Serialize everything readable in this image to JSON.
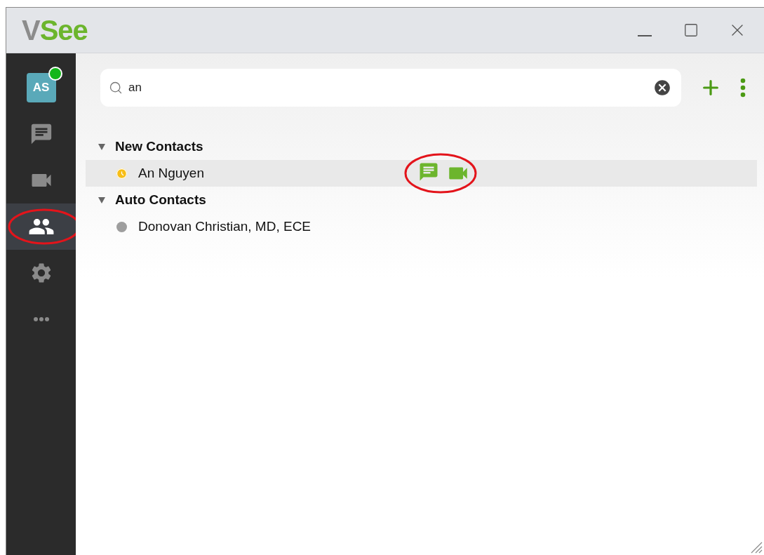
{
  "window": {
    "logo": {
      "mark": "V",
      "name": "See"
    }
  },
  "sidebar": {
    "items": [
      {
        "kind": "avatar",
        "label": "AS",
        "online": true,
        "selected": false,
        "annotated": false
      },
      {
        "kind": "chat",
        "selected": false,
        "annotated": false
      },
      {
        "kind": "video",
        "selected": false,
        "annotated": false
      },
      {
        "kind": "contacts",
        "selected": true,
        "annotated": true
      },
      {
        "kind": "settings",
        "selected": false,
        "annotated": false
      },
      {
        "kind": "more",
        "selected": false,
        "annotated": false
      }
    ]
  },
  "search": {
    "value": "an"
  },
  "groups": [
    {
      "title": "New Contacts",
      "expanded": true,
      "contacts": [
        {
          "name": "An Nguyen",
          "kind": "away",
          "hovered": true,
          "annotated": true
        }
      ]
    },
    {
      "title": "Auto Contacts",
      "expanded": true,
      "contacts": [
        {
          "name": "Donovan Christian, MD, ECE",
          "kind": "offline",
          "hovered": false,
          "annotated": false
        }
      ]
    }
  ]
}
